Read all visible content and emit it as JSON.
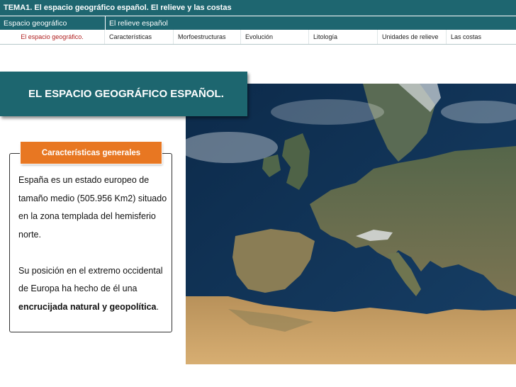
{
  "header": {
    "title": "TEMA1. El espacio geográfico español. El relieve y las costas"
  },
  "sections": [
    {
      "label": "Espacio geográfico"
    },
    {
      "label": "El relieve español"
    }
  ],
  "subnav": [
    {
      "label": "El espacio geográfico.",
      "active": true
    },
    {
      "label": "Características",
      "active": false
    },
    {
      "label": "Morfoestructuras",
      "active": false
    },
    {
      "label": "Evolución",
      "active": false
    },
    {
      "label": "Litología",
      "active": false
    },
    {
      "label": "Unidades de relieve",
      "active": false
    },
    {
      "label": "Las costas",
      "active": false
    }
  ],
  "slide": {
    "title": "EL ESPACIO GEOGRÁFICO ESPAÑOL.",
    "box_label": "Características generales",
    "paragraph1": "España es un estado europeo de tamaño medio (505.956 Km2) situado en la zona templada del hemisferio norte.",
    "paragraph2_prefix": "Su posición en el extremo occidental de Europa ha hecho de él  una ",
    "paragraph2_bold": "encrucijada natural y geopolítica",
    "paragraph2_suffix": "."
  },
  "colors": {
    "header_teal": "#1e6670",
    "active_link": "#b02020",
    "label_orange": "#e87722"
  },
  "icons": {
    "map": "europe-satellite-map"
  }
}
